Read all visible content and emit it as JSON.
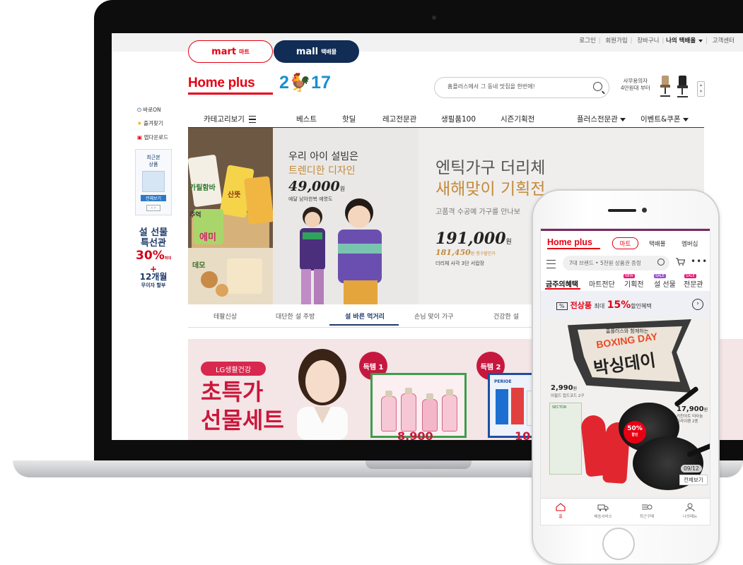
{
  "desktop": {
    "top_links": [
      "로그인",
      "회원가입",
      "장바구니",
      "나의 택배올",
      "고객센터"
    ],
    "tabs": {
      "mart": {
        "label": "mart",
        "sub": "마트"
      },
      "mall": {
        "label": "mall",
        "sub": "택배몰"
      }
    },
    "logo": {
      "text": "Home plus",
      "year_a": "2",
      "year_b": "17"
    },
    "search": {
      "placeholder": "홈플러스에서 그 동네 맛집을 한번에!"
    },
    "promo_ad": {
      "line1": "사무용의자",
      "line2": "4만원대 부터"
    },
    "gnb": [
      "카테고리보기",
      "베스트",
      "핫딜",
      "레고전문관",
      "생필품100",
      "시즌기획전",
      "플러스전문관",
      "이벤트&쿠폰"
    ],
    "side": {
      "on_label": "바로ON",
      "fav_label": "즐겨찾기",
      "app_label": "앱다운로드",
      "box_label1": "최근본",
      "box_label2": "상품",
      "box_btn": "전체보기",
      "promo1": "설 선물",
      "promo2": "특선관",
      "promo_pct": "30%",
      "promo_pct_label": "최대",
      "promo_plus": "+",
      "promo_months": "12개월",
      "promo_months_sub": "무이자 할부"
    },
    "banner": {
      "kid_line1": "우리 아이 설빔은",
      "kid_line2": "트렌디한 디자인",
      "kid_price": "49,000",
      "kid_won": "원",
      "kid_sub": "예달 남아한복 예영도",
      "furn_title1": "엔틱가구 더리체",
      "furn_title2": "새해맞이 기획전",
      "furn_desc": "고품격 수공예 가구를 만나보",
      "furn_price": "191,000",
      "furn_won": "원",
      "furn_sale": "181,450",
      "furn_sale_label": "원 청구할인가",
      "furn_sub": "더리체 사각 3단 서랍장",
      "snack_words": [
        "가릴함바",
        "산뜻",
        "추억",
        "에미",
        "데모"
      ]
    },
    "banner_tabs": [
      "테팔신상",
      "대단한 설 주방",
      "설 바른 먹거리",
      "손님 맞이 가구",
      "건강한 설"
    ],
    "banner2": {
      "lg_pill": "LG생활건강",
      "title1": "초특가",
      "title2": "선물세트",
      "item1": "득템 1",
      "item2": "득템 2",
      "price1": "8,900",
      "price2": "10,9",
      "perioe": "PERIOE"
    }
  },
  "mobile": {
    "logo": "Home plus",
    "mart": "마트",
    "mall": "택배몰",
    "membership": "멤버십",
    "search_placeholder": "7대 브랜드 • 5천원 상품권 증정",
    "tabs": [
      "금주의혜택",
      "마트전단",
      "기획전",
      "설 선물",
      "전문관"
    ],
    "new_badge": "NEW",
    "sale_badge": "SALE",
    "bar": {
      "box": "%",
      "text": "전상품",
      "small": "최대",
      "pct": "15%",
      "tail": "할인혜택"
    },
    "hero": {
      "small": "홈플러스와 함께하는",
      "en": "BOXING DAY",
      "kr": "박싱데이",
      "p1_price": "2,990",
      "p1_won": "원",
      "p1_desc": "이필드 컵드코드 2구",
      "p2_price": "17,900",
      "p2_won": "원",
      "p2_desc1": "키친아트 티타늄",
      "p2_desc2": "프라이팬 2종",
      "pct": "50%",
      "pct_label": "할인",
      "pager": "09/12",
      "view_all": "전체보기",
      "bag_label": "SECTOR"
    },
    "bottom_nav": [
      "홈",
      "배송서비스",
      "최근구매",
      "나의메뉴"
    ]
  },
  "colors": {
    "brand_red": "#e60012",
    "navy": "#112c55",
    "promo_pink": "#c9183c"
  }
}
